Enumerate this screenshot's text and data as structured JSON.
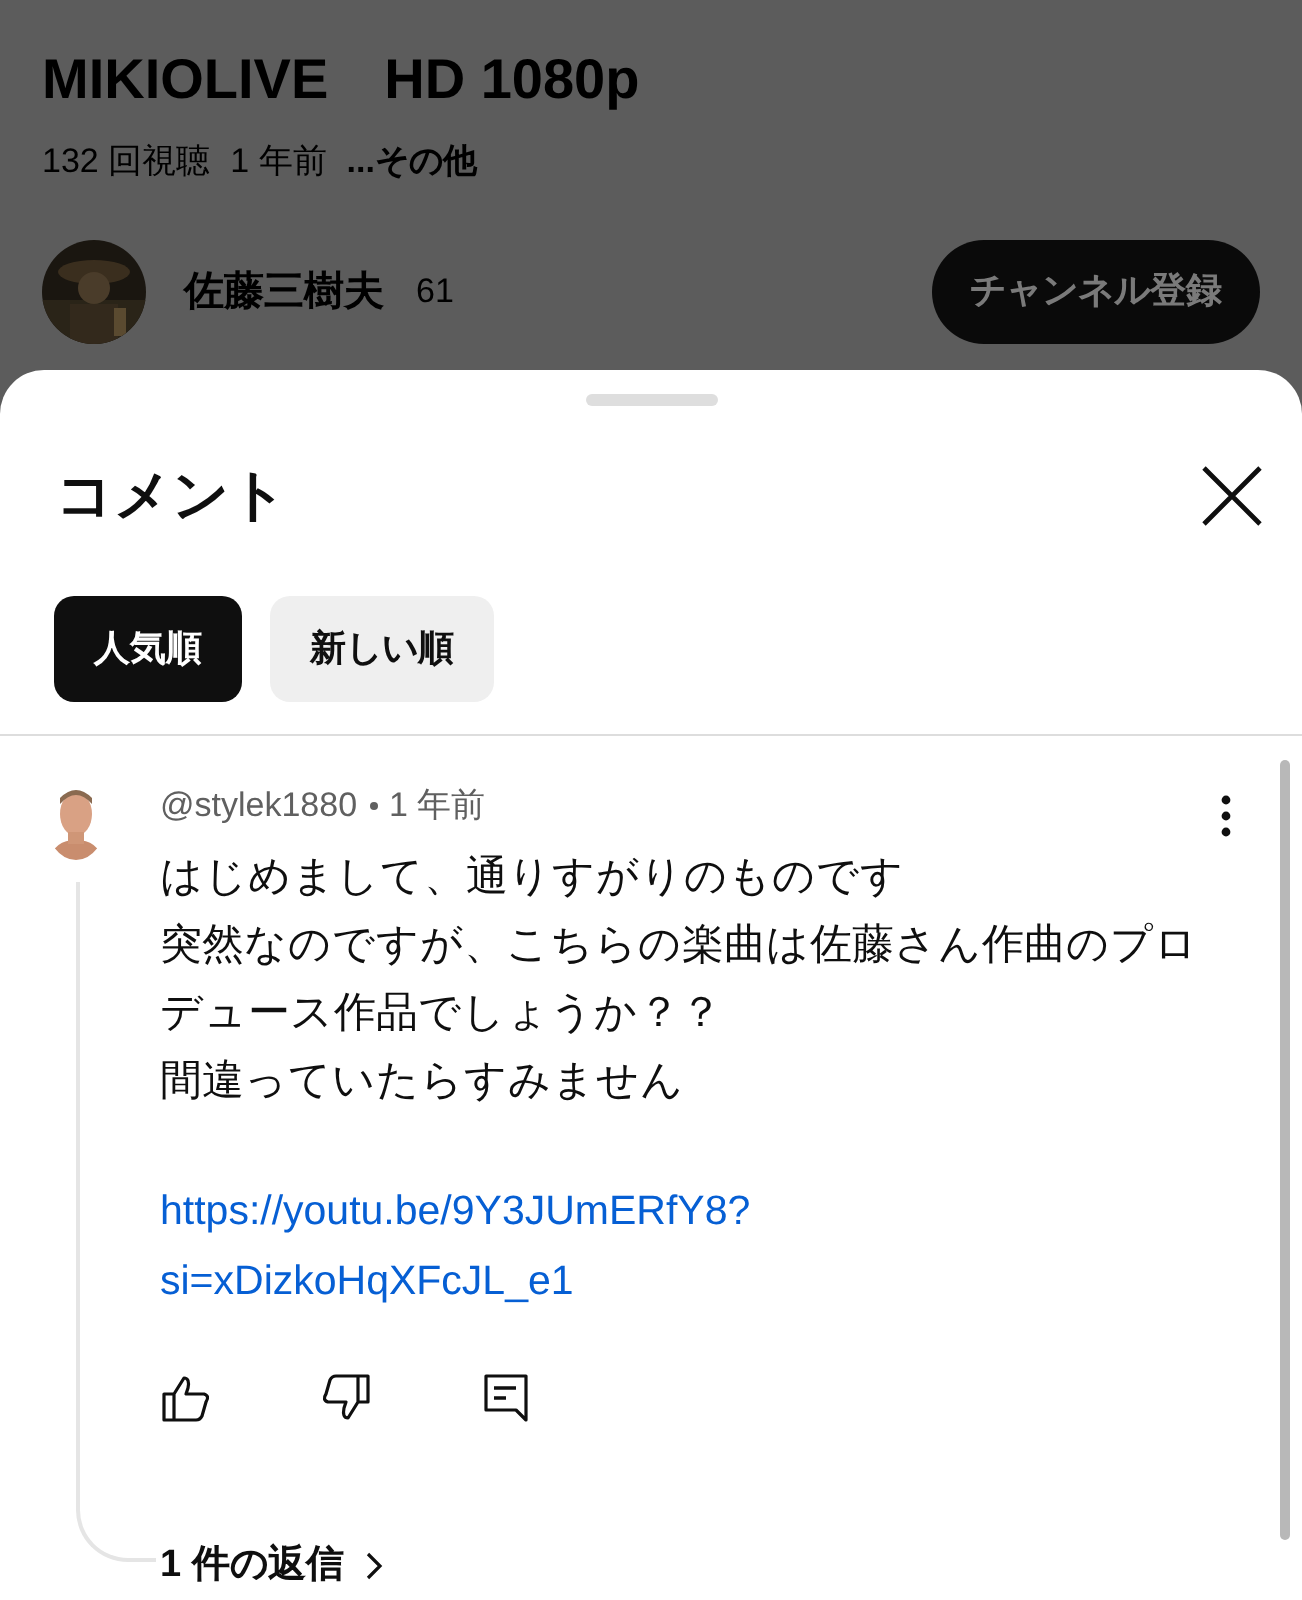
{
  "video": {
    "title": "MIKIOLIVE　HD 1080p",
    "views": "132 回視聴",
    "age": "1 年前",
    "more": "...その他"
  },
  "channel": {
    "avatar": {
      "kind": "picture"
    },
    "name": "佐藤三樹夫",
    "subscribers": "61",
    "subscribe_button": "チャンネル登録"
  },
  "sheet": {
    "title": "コメント",
    "sort_chips": [
      {
        "label": "人気順",
        "selected": true
      },
      {
        "label": "新しい順",
        "selected": false
      }
    ],
    "comment": {
      "avatar": {
        "kind": "picture"
      },
      "author": "@stylek1880",
      "age": "1 年前",
      "lines": [
        "はじめまして、通りすがりのものです",
        "突然なのですが、こちらの楽曲は佐藤さん作曲のプロデュース作品でしょうか？？",
        "間違っていたらすみません"
      ],
      "link": [
        "https://youtu.be/9Y3JUmERfY8?",
        "si=xDizkoHqXFcJL_e1"
      ],
      "replies": "1 件の返信"
    }
  }
}
